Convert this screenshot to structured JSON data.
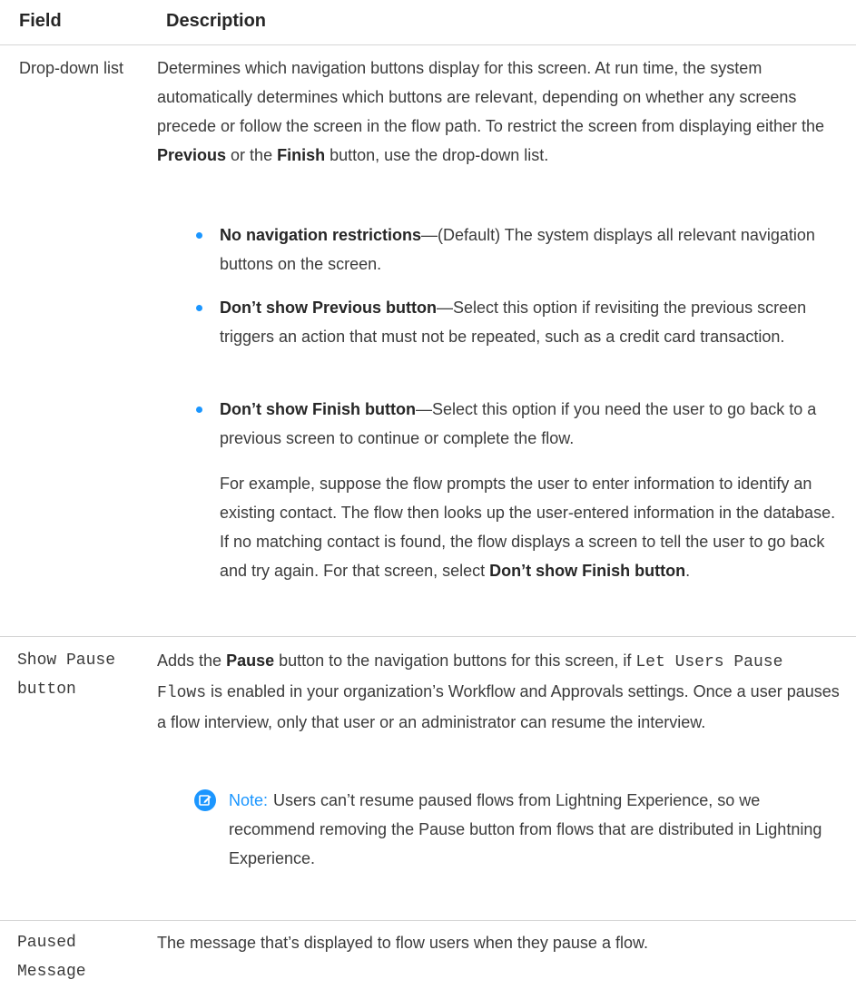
{
  "header": {
    "field": "Field",
    "description": "Description"
  },
  "rows": [
    {
      "field": "Drop-down list",
      "intro": [
        "Determines which navigation buttons display for this screen. At run time, the system automatically determines which buttons are relevant, depending on whether any screens precede or follow the screen in the flow path. To restrict the screen from displaying either the ",
        "Previous",
        " or the ",
        "Finish",
        " button, use the drop-down list."
      ],
      "bullets": [
        {
          "bold": "No navigation restrictions",
          "text": "—(Default) The system displays all relevant navigation buttons on the screen."
        },
        {
          "bold": "Don’t show Previous button",
          "text": "—Select this option if revisiting the previous screen triggers an action that must not be repeated, such as a credit card transaction."
        },
        {
          "bold": "Don’t show Finish button",
          "text": "—Select this option if you need the user to go back to a previous screen to continue or complete the flow."
        }
      ],
      "example": [
        "For example, suppose the flow prompts the user to enter information to identify an existing contact. The flow then looks up the user-entered information in the database. If no matching contact is found, the flow displays a screen to tell the user to go back and try again. For that screen, select ",
        "Don’t show Finish button",
        "."
      ]
    },
    {
      "field_line1": "Show Pause",
      "field_line2": "button",
      "desc": [
        "Adds the ",
        "Pause",
        " button to the navigation buttons for this screen, if ",
        "Let Users Pause Flows",
        " is enabled in your organization’s Workflow and Approvals settings. Once a user pauses a flow interview, only that user or an administrator can resume the interview."
      ],
      "note_label": "Note:",
      "note_text": "Users can’t resume paused flows from Lightning Experience, so we recommend removing the Pause button from flows that are distributed in Lightning Experience."
    },
    {
      "field_line1": "Paused",
      "field_line2": "Message",
      "desc": "The message that’s displayed to flow users when they pause a flow."
    }
  ]
}
